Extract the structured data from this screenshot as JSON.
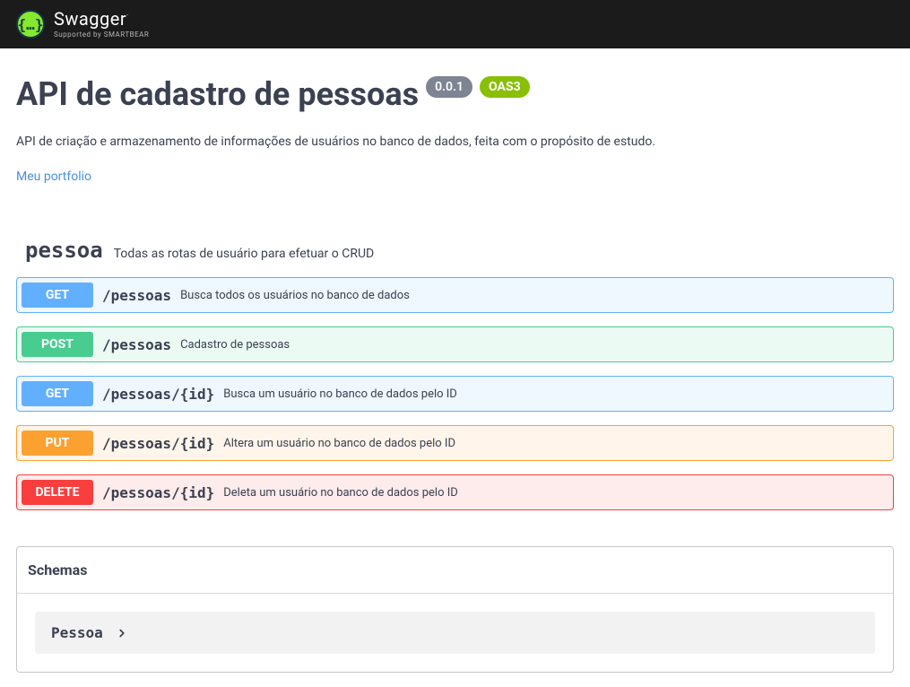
{
  "header": {
    "brand_main": "Swagger",
    "brand_sub": "Supported by SMARTBEAR"
  },
  "info": {
    "title": "API de cadastro de pessoas",
    "version": "0.0.1",
    "oas": "OAS3",
    "description": "API de criação e armazenamento de informações de usuários no banco de dados, feita com o propósito de estudo.",
    "portfolio_link": "Meu portfolio"
  },
  "tag": {
    "name": "pessoa",
    "description": "Todas as rotas de usuário para efetuar o CRUD"
  },
  "operations": [
    {
      "method": "GET",
      "path": "/pessoas",
      "summary": "Busca todos os usuários no banco de dados"
    },
    {
      "method": "POST",
      "path": "/pessoas",
      "summary": "Cadastro de pessoas"
    },
    {
      "method": "GET",
      "path": "/pessoas/{id}",
      "summary": "Busca um usuário no banco de dados pelo ID"
    },
    {
      "method": "PUT",
      "path": "/pessoas/{id}",
      "summary": "Altera um usuário no banco de dados pelo ID"
    },
    {
      "method": "DELETE",
      "path": "/pessoas/{id}",
      "summary": "Deleta um usuário no banco de dados pelo ID"
    }
  ],
  "schemas": {
    "header": "Schemas",
    "items": [
      {
        "name": "Pessoa"
      }
    ]
  }
}
